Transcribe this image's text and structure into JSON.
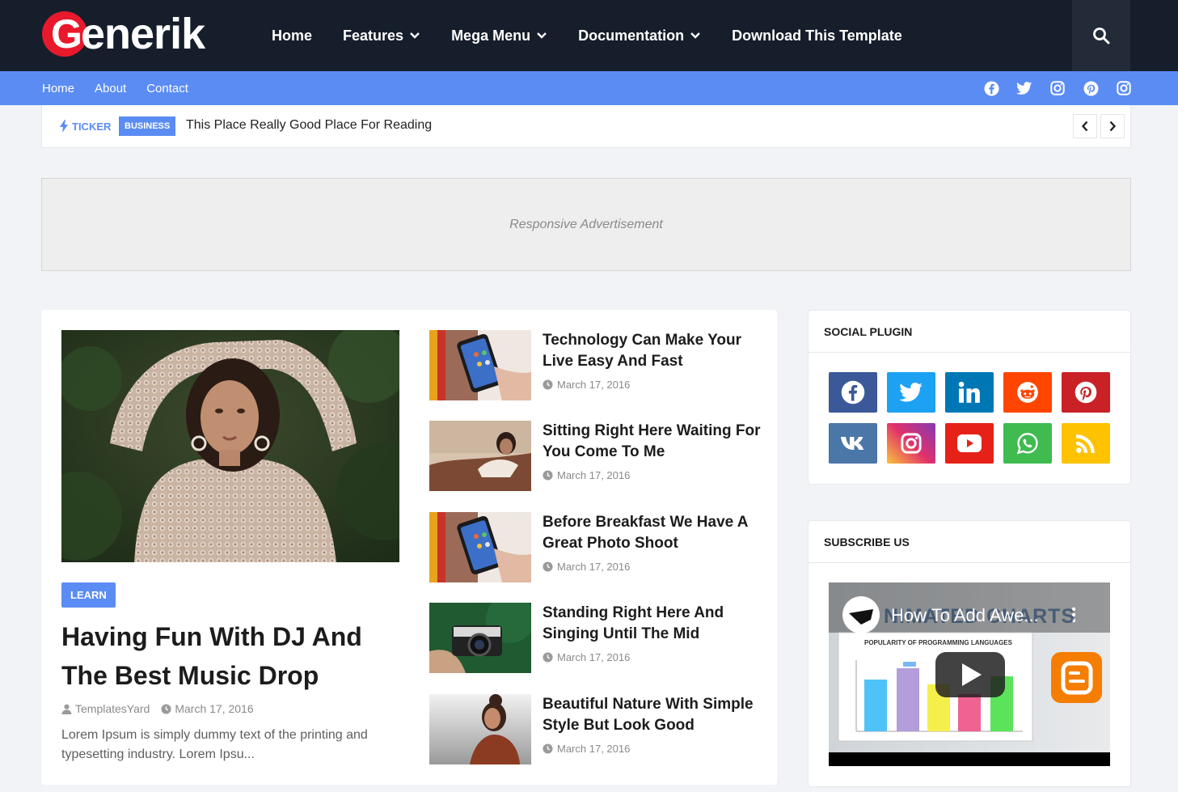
{
  "header": {
    "logo_first": "G",
    "logo_rest": "enerik",
    "nav": [
      {
        "label": "Home",
        "has_dropdown": false
      },
      {
        "label": "Features",
        "has_dropdown": true
      },
      {
        "label": "Mega Menu",
        "has_dropdown": true
      },
      {
        "label": "Documentation",
        "has_dropdown": true
      },
      {
        "label": "Download This Template",
        "has_dropdown": false
      }
    ],
    "search_icon": "search-icon"
  },
  "subnav": {
    "links": [
      "Home",
      "About",
      "Contact"
    ],
    "social_icons": [
      "facebook-icon",
      "twitter-icon",
      "instagram-icon",
      "pinterest-icon",
      "instagram-icon"
    ]
  },
  "ticker": {
    "label": "TICKER",
    "badge": "BUSINESS",
    "text": "This Place Really Good Place For Reading"
  },
  "ad": {
    "text": "Responsive Advertisement"
  },
  "featured": {
    "tag": "LEARN",
    "title": "Having Fun With DJ And The Best Music Drop",
    "author": "TemplatesYard",
    "date": "March 17, 2016",
    "excerpt": "Lorem Ipsum is simply dummy text of the printing and typesetting industry. Lorem Ipsu..."
  },
  "posts": [
    {
      "title": "Technology Can Make Your Live Easy And Fast",
      "date": "March 17, 2016"
    },
    {
      "title": "Sitting Right Here Waiting For You Come To Me",
      "date": "March 17, 2016"
    },
    {
      "title": "Before Breakfast We Have A Great Photo Shoot",
      "date": "March 17, 2016"
    },
    {
      "title": "Standing Right Here And Singing Until The Mid",
      "date": "March 17, 2016"
    },
    {
      "title": "Beautiful Nature With Simple Style But Look Good",
      "date": "March 17, 2016"
    }
  ],
  "social_plugin": {
    "title": "SOCIAL PLUGIN",
    "buttons": [
      {
        "icon": "facebook-icon",
        "color": "#3b5998"
      },
      {
        "icon": "twitter-icon",
        "color": "#1da1f2"
      },
      {
        "icon": "linkedin-icon",
        "color": "#0077b5"
      },
      {
        "icon": "reddit-icon",
        "color": "#ff4500"
      },
      {
        "icon": "pinterest-icon",
        "color": "#ca2127"
      },
      {
        "icon": "vk-icon",
        "color": "#4a76a8"
      },
      {
        "icon": "instagram-icon",
        "color": "#c13584"
      },
      {
        "icon": "youtube-icon",
        "color": "#e62117"
      },
      {
        "icon": "whatsapp-icon",
        "color": "#3fbb50"
      },
      {
        "icon": "rss-icon",
        "color": "#ffc200"
      }
    ]
  },
  "subscribe": {
    "title": "SUBSCRIBE US",
    "video_title": "How To Add Awe...",
    "video_banner": "NIMATED CHARTS",
    "chart_heading": "POPULARITY OF PROGRAMMING LANGUAGES"
  },
  "colors": {
    "header_bg": "#161e2b",
    "accent": "#5b8cf3",
    "logo_red": "#e8192c"
  }
}
